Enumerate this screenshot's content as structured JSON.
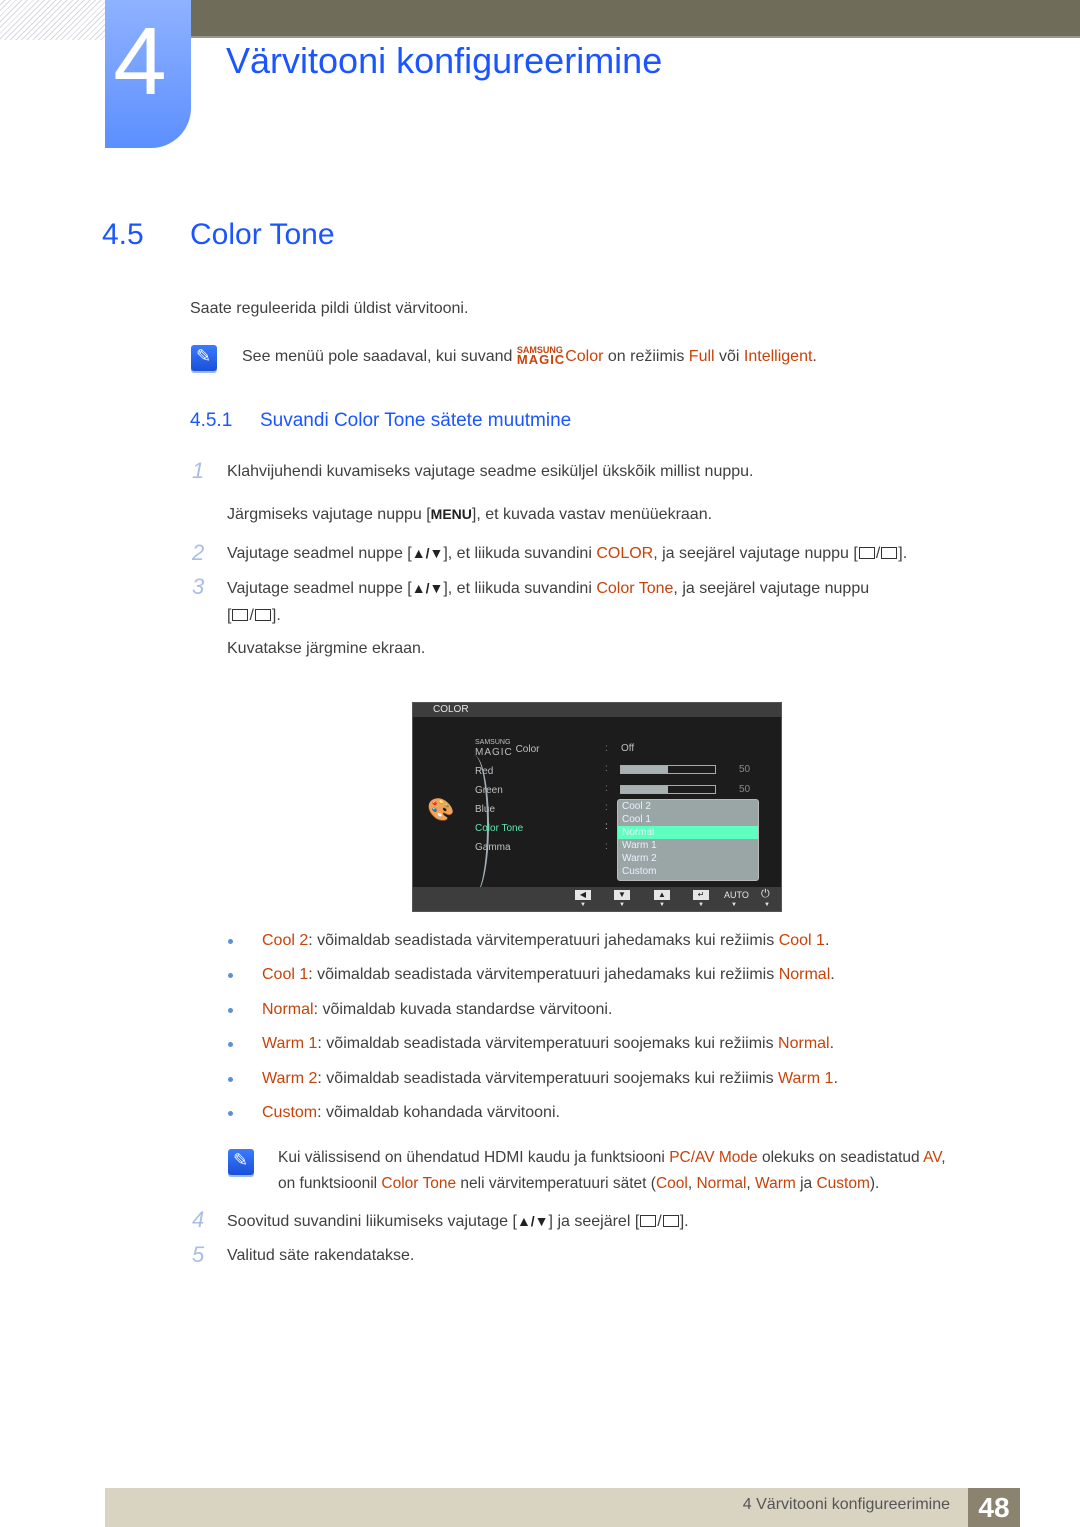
{
  "chapter": {
    "number": "4",
    "title": "Värvitooni konfigureerimine"
  },
  "section": {
    "number": "4.5",
    "title": "Color Tone"
  },
  "intro": "Saate reguleerida pildi üldist värvitooni.",
  "note1": {
    "pre": "See menüü pole saadaval, kui suvand ",
    "magic_top": "SAMSUNG",
    "magic_bottom": "MAGIC",
    "magic_word": "Color",
    "mid": " on režiimis ",
    "hl1": "Full",
    "conj": " või ",
    "hl2": "Intelligent",
    "end": "."
  },
  "subsection": {
    "number": "4.5.1",
    "title": "Suvandi Color Tone sätete muutmine"
  },
  "steps": [
    {
      "n": "1",
      "line1": "Klahvijuhendi kuvamiseks vajutage seadme esiküljel ükskõik millist nuppu.",
      "line2_pre": "Järgmiseks vajutage nuppu [",
      "key": "MENU",
      "line2_post": "], et kuvada vastav menüüekraan."
    },
    {
      "n": "2",
      "pre": "Vajutage seadmel nuppe [",
      "arrows": "▲/▼",
      "mid": "], et liikuda suvandini ",
      "hl": "COLOR",
      "post": ", ja seejärel vajutage nuppu [",
      "end": "]."
    },
    {
      "n": "3",
      "pre": "Vajutage seadmel nuppe [",
      "arrows": "▲/▼",
      "mid": "], et liikuda suvandini ",
      "hl": "Color Tone",
      "post": ", ja seejärel vajutage nuppu",
      "line2_pre": "[",
      "line2_end": "].",
      "line3": "Kuvatakse järgmine ekraan."
    },
    {
      "n": "4",
      "pre": "Soovitud suvandini liikumiseks vajutage [",
      "arrows": "▲/▼",
      "mid": "] ja seejärel [",
      "end": "]."
    },
    {
      "n": "5",
      "text": "Valitud säte rakendatakse."
    }
  ],
  "osd": {
    "header": "COLOR",
    "items": [
      {
        "label_top": "SAMSUNG",
        "label_bottom": "MAGIC",
        "label": "Color",
        "value": "Off"
      },
      {
        "label": "Red",
        "value": 50,
        "max": 100
      },
      {
        "label": "Green",
        "value": 50,
        "max": 100
      },
      {
        "label": "Blue"
      },
      {
        "label": "Color Tone",
        "selected": true
      },
      {
        "label": "Gamma"
      }
    ],
    "dropdown": [
      "Cool 2",
      "Cool 1",
      "Normal",
      "Warm 1",
      "Warm 2",
      "Custom"
    ],
    "dropdown_selected": "Normal",
    "footer_buttons": [
      "◀",
      "▼",
      "▲",
      "↵",
      "AUTO",
      "⏻"
    ],
    "selected_color": "#5fffbf"
  },
  "options": [
    {
      "name": "Cool 2",
      "text": ": võimaldab seadistada värvitemperatuuri jahedamaks kui režiimis ",
      "ref": "Cool 1",
      "end": "."
    },
    {
      "name": "Cool 1",
      "text": ": võimaldab seadistada värvitemperatuuri jahedamaks kui režiimis ",
      "ref": "Normal",
      "end": "."
    },
    {
      "name": "Normal",
      "text": ": võimaldab kuvada standardse värvitooni.",
      "ref": "",
      "end": ""
    },
    {
      "name": "Warm 1",
      "text": ": võimaldab seadistada värvitemperatuuri soojemaks kui režiimis ",
      "ref": "Normal",
      "end": "."
    },
    {
      "name": "Warm 2",
      "text": ": võimaldab seadistada värvitemperatuuri soojemaks kui režiimis ",
      "ref": "Warm 1",
      "end": "."
    },
    {
      "name": "Custom",
      "text": ": võimaldab kohandada värvitooni.",
      "ref": "",
      "end": ""
    }
  ],
  "note2": {
    "a": "Kui välissisend on ühendatud HDMI kaudu ja funktsiooni ",
    "b": "PC/AV Mode",
    "c": " olekuks on seadistatud ",
    "d": "AV",
    "e": ",",
    "f": "on funktsioonil ",
    "g": "Color Tone",
    "h": " neli värvitemperatuuri sätet (",
    "i": "Cool",
    "j": ", ",
    "k": "Normal",
    "l": ", ",
    "m": "Warm",
    "n": " ja ",
    "o": "Custom",
    "p": ")."
  },
  "footer": {
    "title": "4 Värvitooni konfigureerimine",
    "page": "48"
  },
  "colors": {
    "accent_blue": "#1a55ff",
    "highlight": "#c8430a",
    "topbar": "#6f6c59",
    "footer": "#d9d3c1"
  }
}
